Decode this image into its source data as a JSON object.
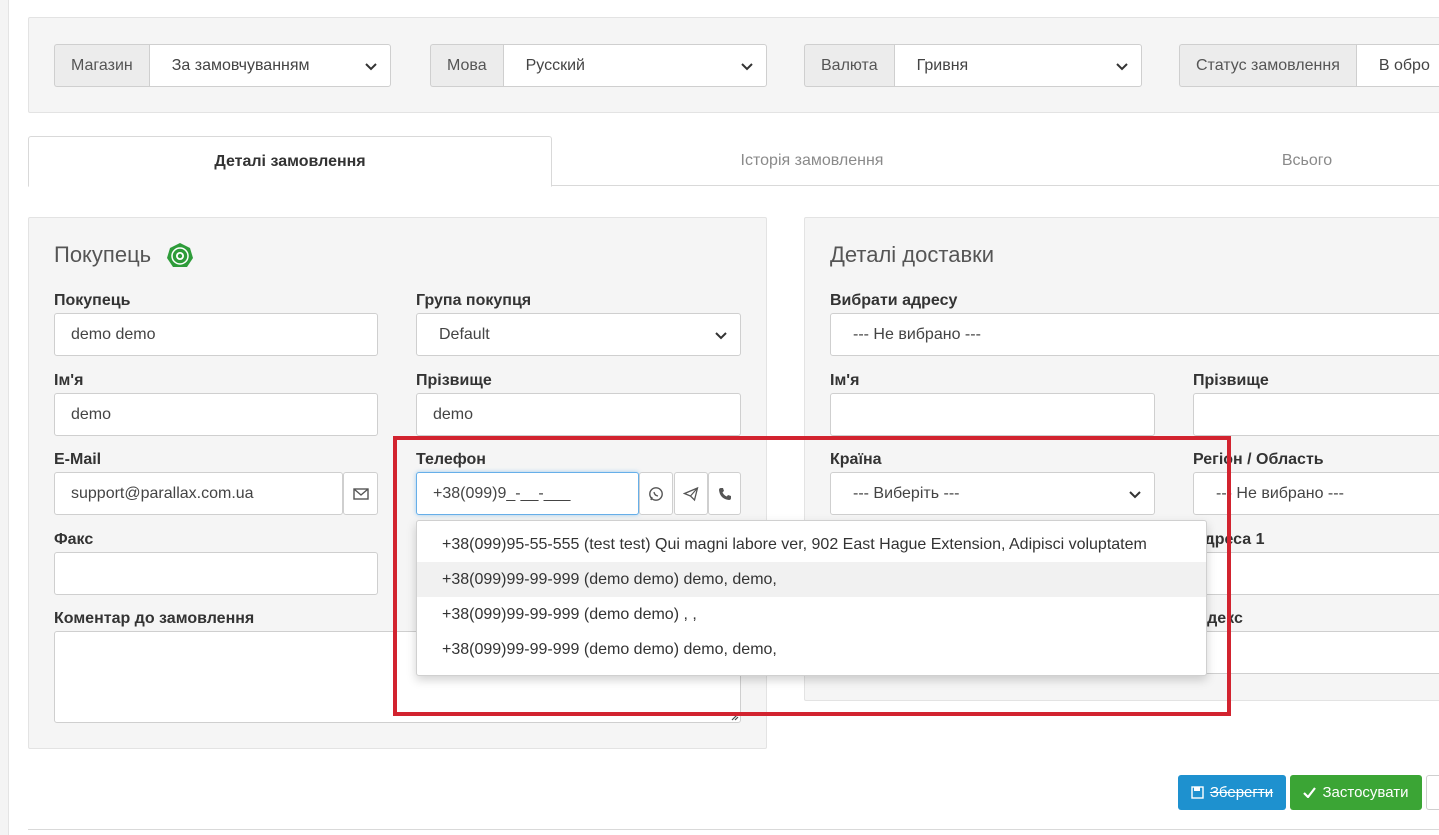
{
  "filter_bar": {
    "store_label": "Магазин",
    "store_value": "За замовчуванням",
    "language_label": "Мова",
    "language_value": "Русский",
    "currency_label": "Валюта",
    "currency_value": "Гривня",
    "status_label": "Статус замовлення",
    "status_value": "В обро"
  },
  "tabs": {
    "details": "Деталі замовлення",
    "history": "Історія замовлення",
    "total": "Всього"
  },
  "customer": {
    "title": "Покупець",
    "customer_label": "Покупець",
    "customer_value": "demo demo",
    "group_label": "Група покупця",
    "group_value": "Default",
    "firstname_label": "Ім'я",
    "firstname_value": "demo",
    "lastname_label": "Прізвище",
    "lastname_value": "demo",
    "email_label": "E-Mail",
    "email_value": "support@parallax.com.ua",
    "phone_label": "Телефон",
    "phone_value": "+38(099)9_-__-___",
    "fax_label": "Факс",
    "comment_label": "Коментар до замовлення"
  },
  "delivery": {
    "title": "Деталі доставки",
    "address_label": "Вибрати адресу",
    "address_value": "--- Не вибрано ---",
    "firstname_label": "Ім'я",
    "lastname_label": "Прізвище",
    "country_label": "Країна",
    "country_value": "--- Виберіть ---",
    "region_label": "Регіон / Область",
    "region_value": "--- Не вибрано ---",
    "address1_label": "Адреса 1",
    "postcode_label": "Індекс"
  },
  "autocomplete": [
    "+38(099)95-55-555 (test test) Qui magni labore ver, 902 East Hague Extension, Adipisci voluptatem",
    "+38(099)99-99-999 (demo demo) demo, demo,",
    "+38(099)99-99-999 (demo demo) , ,",
    "+38(099)99-99-999 (demo demo) demo, demo,"
  ],
  "buttons": {
    "save": "Зберегти",
    "apply": "Застосувати"
  },
  "colors": {
    "primary": "#1e91cf",
    "success": "#3ba535",
    "annotation": "#d2232f"
  }
}
